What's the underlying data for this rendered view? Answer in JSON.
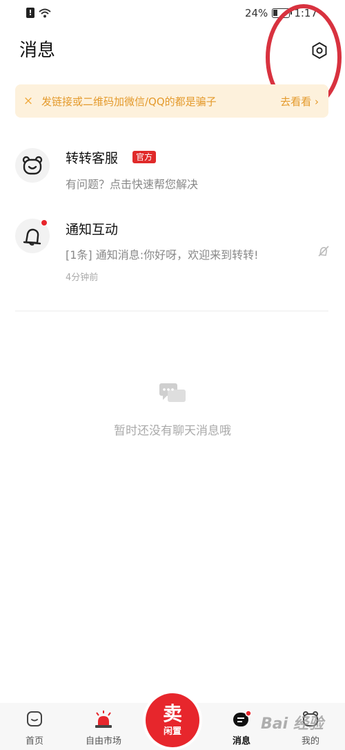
{
  "status_bar": {
    "battery": "24%",
    "time": "1:17"
  },
  "header": {
    "title": "消息"
  },
  "banner": {
    "close": "×",
    "text": "发链接或二维码加微信/QQ的都是骗子",
    "link": "去看看 ›"
  },
  "conversations": [
    {
      "name": "转转客服",
      "tag": "官方",
      "preview": "有问题？点击快速帮您解决"
    },
    {
      "name": "通知互动",
      "preview": "[1条] 通知消息:你好呀，欢迎来到转转!",
      "time": "4分钟前"
    }
  ],
  "empty_state": {
    "text": "暂时还没有聊天消息哦"
  },
  "bottom_nav": {
    "items": [
      {
        "label": "首页",
        "icon": "home-icon"
      },
      {
        "label": "自由市场",
        "icon": "siren-icon"
      },
      {
        "label": "消息",
        "icon": "message-icon"
      },
      {
        "label": "我的",
        "icon": "profile-icon"
      }
    ],
    "sell": {
      "main": "卖",
      "sub": "闲置"
    }
  },
  "watermark": "Bai 经验",
  "colors": {
    "accent": "#e7262c",
    "banner_bg": "#fdf1dc",
    "banner_text": "#e49a2c"
  }
}
